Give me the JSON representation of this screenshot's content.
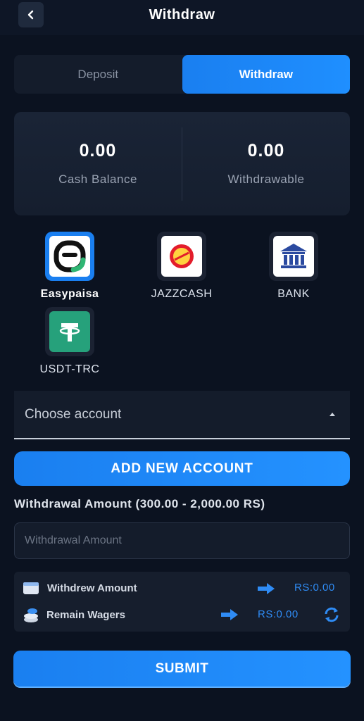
{
  "header": {
    "title": "Withdraw",
    "back_icon": "chevron-left-icon"
  },
  "tabs": [
    {
      "label": "Deposit",
      "active": false
    },
    {
      "label": "Withdraw",
      "active": true
    }
  ],
  "balance": {
    "cash_value": "0.00",
    "cash_label": "Cash Balance",
    "withdrawable_value": "0.00",
    "withdrawable_label": "Withdrawable"
  },
  "methods": [
    {
      "label": "Easypaisa",
      "icon": "easypaisa-logo-icon",
      "selected": true
    },
    {
      "label": "JAZZCASH",
      "icon": "jazzcash-logo-icon",
      "selected": false
    },
    {
      "label": "BANK",
      "icon": "bank-icon",
      "selected": false
    },
    {
      "label": "USDT-TRC",
      "icon": "tether-icon",
      "selected": false
    }
  ],
  "account_select": {
    "placeholder": "Choose account"
  },
  "add_account_label": "ADD NEW ACCOUNT",
  "amount": {
    "label": "Withdrawal Amount (300.00 - 2,000.00 RS)",
    "placeholder": "Withdrawal Amount"
  },
  "info": {
    "withdrew_label": "Withdrew Amount",
    "withdrew_value": "RS:0.00",
    "wagers_label": "Remain Wagers",
    "wagers_value": "RS:0.00"
  },
  "submit_label": "SUBMIT",
  "colors": {
    "accent": "#1a7ff0",
    "background": "#0b1220",
    "value_blue": "#2f8cf5"
  }
}
